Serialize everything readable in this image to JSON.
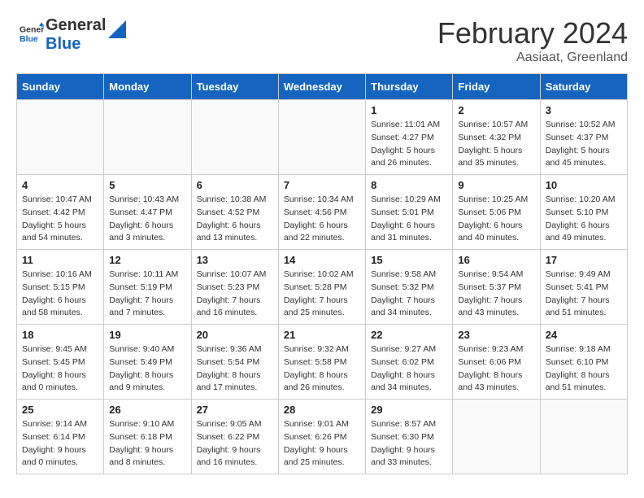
{
  "header": {
    "logo_general": "General",
    "logo_blue": "Blue",
    "month_title": "February 2024",
    "location": "Aasiaat, Greenland"
  },
  "days_of_week": [
    "Sunday",
    "Monday",
    "Tuesday",
    "Wednesday",
    "Thursday",
    "Friday",
    "Saturday"
  ],
  "weeks": [
    [
      {
        "day": "",
        "sunrise": "",
        "sunset": "",
        "daylight": ""
      },
      {
        "day": "",
        "sunrise": "",
        "sunset": "",
        "daylight": ""
      },
      {
        "day": "",
        "sunrise": "",
        "sunset": "",
        "daylight": ""
      },
      {
        "day": "",
        "sunrise": "",
        "sunset": "",
        "daylight": ""
      },
      {
        "day": "1",
        "sunrise": "Sunrise: 11:01 AM",
        "sunset": "Sunset: 4:27 PM",
        "daylight": "Daylight: 5 hours and 26 minutes."
      },
      {
        "day": "2",
        "sunrise": "Sunrise: 10:57 AM",
        "sunset": "Sunset: 4:32 PM",
        "daylight": "Daylight: 5 hours and 35 minutes."
      },
      {
        "day": "3",
        "sunrise": "Sunrise: 10:52 AM",
        "sunset": "Sunset: 4:37 PM",
        "daylight": "Daylight: 5 hours and 45 minutes."
      }
    ],
    [
      {
        "day": "4",
        "sunrise": "Sunrise: 10:47 AM",
        "sunset": "Sunset: 4:42 PM",
        "daylight": "Daylight: 5 hours and 54 minutes."
      },
      {
        "day": "5",
        "sunrise": "Sunrise: 10:43 AM",
        "sunset": "Sunset: 4:47 PM",
        "daylight": "Daylight: 6 hours and 3 minutes."
      },
      {
        "day": "6",
        "sunrise": "Sunrise: 10:38 AM",
        "sunset": "Sunset: 4:52 PM",
        "daylight": "Daylight: 6 hours and 13 minutes."
      },
      {
        "day": "7",
        "sunrise": "Sunrise: 10:34 AM",
        "sunset": "Sunset: 4:56 PM",
        "daylight": "Daylight: 6 hours and 22 minutes."
      },
      {
        "day": "8",
        "sunrise": "Sunrise: 10:29 AM",
        "sunset": "Sunset: 5:01 PM",
        "daylight": "Daylight: 6 hours and 31 minutes."
      },
      {
        "day": "9",
        "sunrise": "Sunrise: 10:25 AM",
        "sunset": "Sunset: 5:06 PM",
        "daylight": "Daylight: 6 hours and 40 minutes."
      },
      {
        "day": "10",
        "sunrise": "Sunrise: 10:20 AM",
        "sunset": "Sunset: 5:10 PM",
        "daylight": "Daylight: 6 hours and 49 minutes."
      }
    ],
    [
      {
        "day": "11",
        "sunrise": "Sunrise: 10:16 AM",
        "sunset": "Sunset: 5:15 PM",
        "daylight": "Daylight: 6 hours and 58 minutes."
      },
      {
        "day": "12",
        "sunrise": "Sunrise: 10:11 AM",
        "sunset": "Sunset: 5:19 PM",
        "daylight": "Daylight: 7 hours and 7 minutes."
      },
      {
        "day": "13",
        "sunrise": "Sunrise: 10:07 AM",
        "sunset": "Sunset: 5:23 PM",
        "daylight": "Daylight: 7 hours and 16 minutes."
      },
      {
        "day": "14",
        "sunrise": "Sunrise: 10:02 AM",
        "sunset": "Sunset: 5:28 PM",
        "daylight": "Daylight: 7 hours and 25 minutes."
      },
      {
        "day": "15",
        "sunrise": "Sunrise: 9:58 AM",
        "sunset": "Sunset: 5:32 PM",
        "daylight": "Daylight: 7 hours and 34 minutes."
      },
      {
        "day": "16",
        "sunrise": "Sunrise: 9:54 AM",
        "sunset": "Sunset: 5:37 PM",
        "daylight": "Daylight: 7 hours and 43 minutes."
      },
      {
        "day": "17",
        "sunrise": "Sunrise: 9:49 AM",
        "sunset": "Sunset: 5:41 PM",
        "daylight": "Daylight: 7 hours and 51 minutes."
      }
    ],
    [
      {
        "day": "18",
        "sunrise": "Sunrise: 9:45 AM",
        "sunset": "Sunset: 5:45 PM",
        "daylight": "Daylight: 8 hours and 0 minutes."
      },
      {
        "day": "19",
        "sunrise": "Sunrise: 9:40 AM",
        "sunset": "Sunset: 5:49 PM",
        "daylight": "Daylight: 8 hours and 9 minutes."
      },
      {
        "day": "20",
        "sunrise": "Sunrise: 9:36 AM",
        "sunset": "Sunset: 5:54 PM",
        "daylight": "Daylight: 8 hours and 17 minutes."
      },
      {
        "day": "21",
        "sunrise": "Sunrise: 9:32 AM",
        "sunset": "Sunset: 5:58 PM",
        "daylight": "Daylight: 8 hours and 26 minutes."
      },
      {
        "day": "22",
        "sunrise": "Sunrise: 9:27 AM",
        "sunset": "Sunset: 6:02 PM",
        "daylight": "Daylight: 8 hours and 34 minutes."
      },
      {
        "day": "23",
        "sunrise": "Sunrise: 9:23 AM",
        "sunset": "Sunset: 6:06 PM",
        "daylight": "Daylight: 8 hours and 43 minutes."
      },
      {
        "day": "24",
        "sunrise": "Sunrise: 9:18 AM",
        "sunset": "Sunset: 6:10 PM",
        "daylight": "Daylight: 8 hours and 51 minutes."
      }
    ],
    [
      {
        "day": "25",
        "sunrise": "Sunrise: 9:14 AM",
        "sunset": "Sunset: 6:14 PM",
        "daylight": "Daylight: 9 hours and 0 minutes."
      },
      {
        "day": "26",
        "sunrise": "Sunrise: 9:10 AM",
        "sunset": "Sunset: 6:18 PM",
        "daylight": "Daylight: 9 hours and 8 minutes."
      },
      {
        "day": "27",
        "sunrise": "Sunrise: 9:05 AM",
        "sunset": "Sunset: 6:22 PM",
        "daylight": "Daylight: 9 hours and 16 minutes."
      },
      {
        "day": "28",
        "sunrise": "Sunrise: 9:01 AM",
        "sunset": "Sunset: 6:26 PM",
        "daylight": "Daylight: 9 hours and 25 minutes."
      },
      {
        "day": "29",
        "sunrise": "Sunrise: 8:57 AM",
        "sunset": "Sunset: 6:30 PM",
        "daylight": "Daylight: 9 hours and 33 minutes."
      },
      {
        "day": "",
        "sunrise": "",
        "sunset": "",
        "daylight": ""
      },
      {
        "day": "",
        "sunrise": "",
        "sunset": "",
        "daylight": ""
      }
    ]
  ]
}
